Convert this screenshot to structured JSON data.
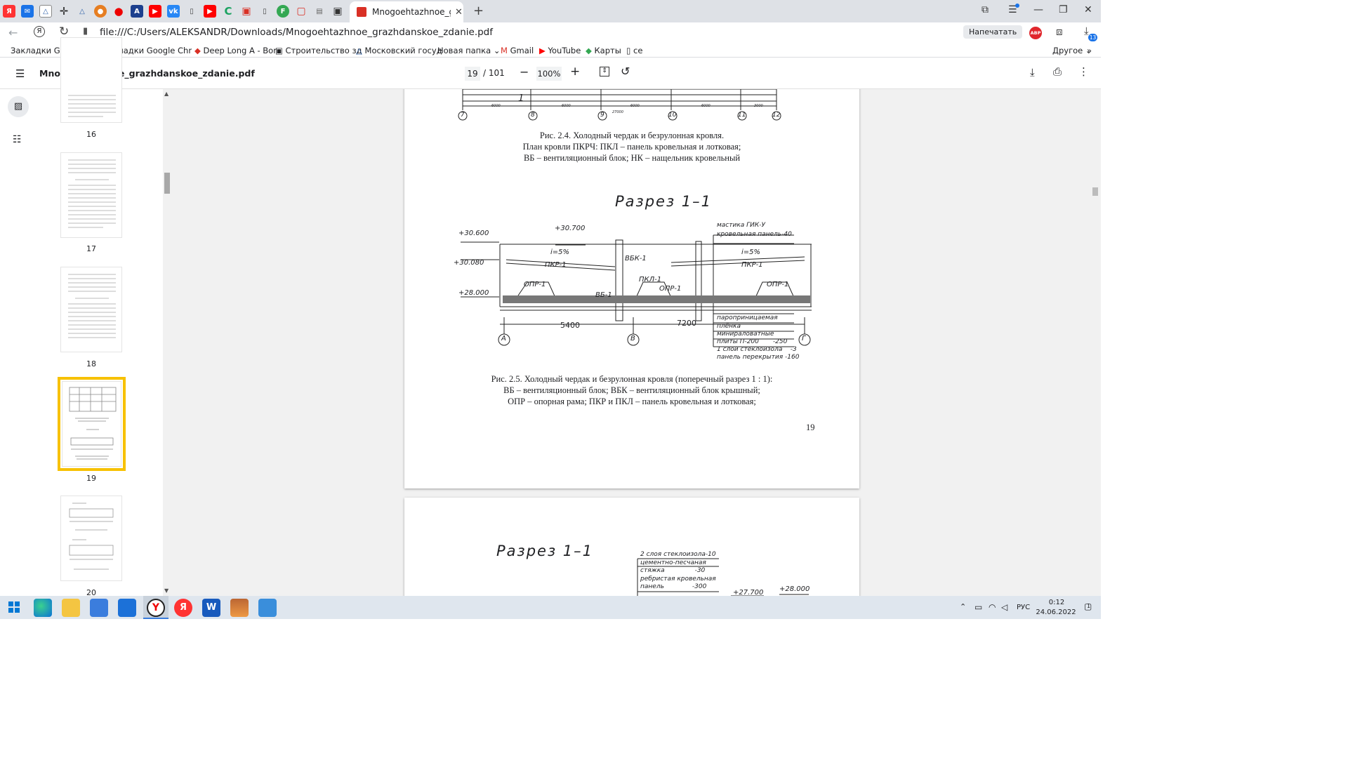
{
  "browser": {
    "tab_title": "Mnogoehtazhnoe_grazh",
    "url": "file:///C:/Users/ALEKSANDR/Downloads/Mnogoehtazhnoe_grazhdanskoe_zdanie.pdf",
    "print_button": "Напечатать",
    "abp_badge": "ABP",
    "downloads_badge": "13"
  },
  "bookmarks": {
    "items": [
      "Закладки Google Chr",
      "Закладки Google Chr",
      "Deep Long A - Bor",
      "Строительство зд",
      "Московский госуд",
      "Новая папка",
      "Gmail",
      "YouTube",
      "Карты",
      "се"
    ],
    "other": "Другое"
  },
  "pdf": {
    "filename": "Mnogoehtazhnoe_grazhdanskoe_zdanie.pdf",
    "page_current": "19",
    "page_total": "/ 101",
    "zoom": "100%"
  },
  "thumbnails": {
    "pages": [
      "16",
      "17",
      "18",
      "19",
      "20"
    ],
    "selected": "19"
  },
  "page19": {
    "dims_top": [
      "6000",
      "6000",
      "6000",
      "6000",
      "3000"
    ],
    "dim_total": "27000",
    "axes_top": [
      "7",
      "8",
      "9",
      "10",
      "11",
      "12"
    ],
    "axis_label_1": "1",
    "caption_24": [
      "Рис. 2.4. Холодный чердак и безрулонная кровля.",
      "План кровли ПКРЧ: ПКЛ – панель кровельная и лотковая;",
      "ВБ – вентиляционный блок; НК – нащельник кровельный"
    ],
    "section_title": "Разрез 1–1",
    "elevations": [
      "+30.600",
      "+30.080",
      "+28.000",
      "+30.700"
    ],
    "slopes": [
      "i=5%",
      "i=5%"
    ],
    "labels": [
      "ПКР-1",
      "ПКР-1",
      "ВБК-1",
      "ПКЛ-1",
      "ОПР-1",
      "ОПР-1",
      "ОПР-1",
      "ВБ-1"
    ],
    "legend_top": [
      "мастика ГИК-У",
      "кровельная панель-40"
    ],
    "legend_bottom": [
      "пароприницаемая",
      "плёнка",
      "минираловатные",
      "плиты П-200       -250",
      "1 слой стеклоизола    -3",
      "панель перекрытия -160"
    ],
    "dims_bottom": [
      "5400",
      "7200"
    ],
    "axes_bottom": [
      "А",
      "В",
      "Г"
    ],
    "caption_25": [
      "Рис. 2.5. Холодный чердак и безрулонная кровля (поперечный разрез 1 : 1):",
      "ВБ – вентиляционный блок; ВБК – вентиляционный блок крышный;",
      "ОПР – опорная рама; ПКР и ПКЛ – панель кровельная и лотковая;"
    ],
    "page_number": "19"
  },
  "page20": {
    "section_title": "Разрез 1–1",
    "legend": [
      "2 слоя стеклоизола-10",
      "цементно-песчаная",
      "стяжка               -30",
      "ребристая кровельная",
      "панель              -300"
    ],
    "elevations": [
      "+27.700",
      "+28.000"
    ]
  },
  "taskbar": {
    "lang": "РУС",
    "time": "0:12",
    "date": "24.06.2022",
    "notif": "1"
  }
}
